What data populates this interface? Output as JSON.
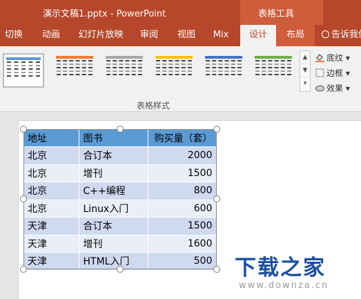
{
  "window": {
    "doc_title": "演示文稿1.pptx - PowerPoint",
    "context_title": "表格工具"
  },
  "tabs": [
    {
      "label": "切换"
    },
    {
      "label": "动画"
    },
    {
      "label": "幻灯片放映"
    },
    {
      "label": "审阅"
    },
    {
      "label": "视图"
    },
    {
      "label": "Mix"
    },
    {
      "label": "设计"
    },
    {
      "label": "布局"
    }
  ],
  "active_tab": "设计",
  "tell_me": "告诉我你",
  "ribbon": {
    "group_label": "表格样式",
    "shading_label": "底纹",
    "border_label": "边框",
    "effects_label": "效果",
    "gallery_colors": [
      "#5b9bd5",
      "#ed7d31",
      "#a5a5a5",
      "#ffc000",
      "#4472c4",
      "#70ad47"
    ]
  },
  "table": {
    "headers": [
      "地址",
      "图书",
      "购买量（套）"
    ],
    "rows": [
      [
        "北京",
        "合订本",
        "2000"
      ],
      [
        "北京",
        "增刊",
        "1500"
      ],
      [
        "北京",
        "C++编程",
        "800"
      ],
      [
        "北京",
        "Linux入门",
        "600"
      ],
      [
        "天津",
        "合订本",
        "1500"
      ],
      [
        "天津",
        "增刊",
        "1600"
      ],
      [
        "天津",
        "HTML入门",
        "500"
      ]
    ]
  },
  "watermark": {
    "logo_text": "下载之家",
    "url": "www.downza.cn"
  },
  "colors": {
    "accent": "#b7472a",
    "context_band": "#cf5c3a",
    "header_fill": "#5b9bd5",
    "band_odd": "#cfdaef",
    "band_even": "#e9eef7"
  }
}
